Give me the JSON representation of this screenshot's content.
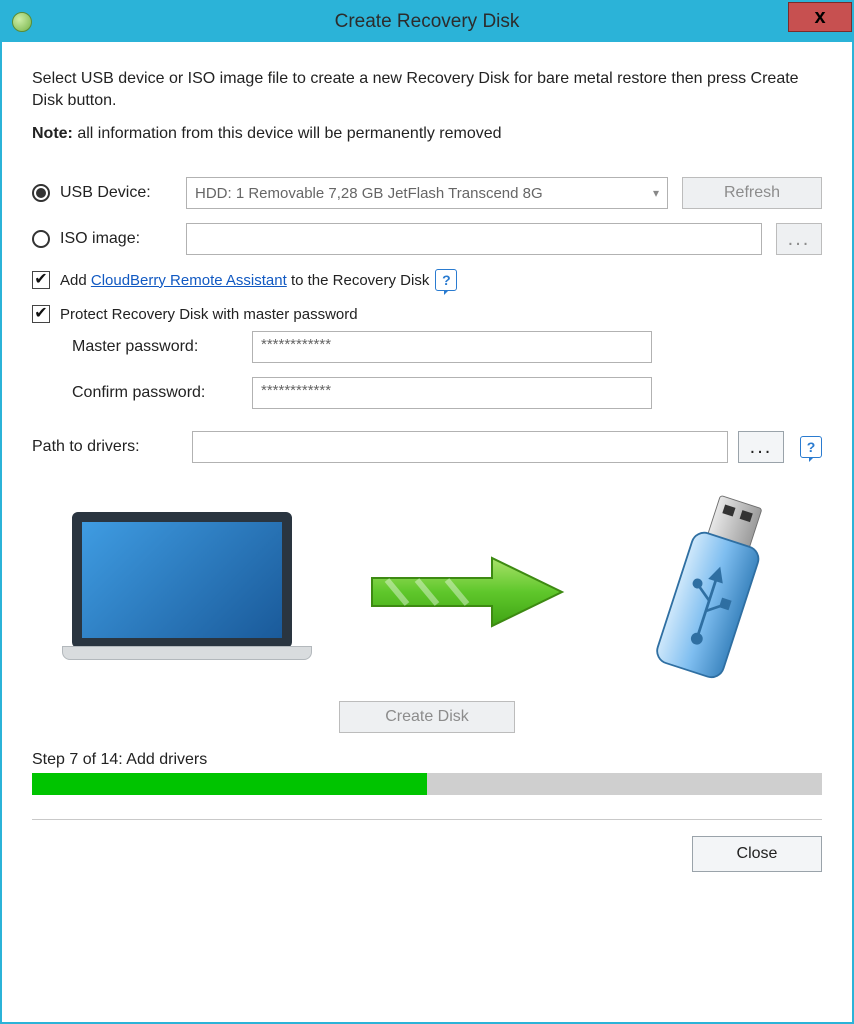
{
  "window": {
    "title": "Create Recovery Disk",
    "close_label": "x"
  },
  "intro": "Select USB device or ISO image file to create a new Recovery Disk for bare metal restore then press Create Disk button.",
  "note_prefix": "Note:",
  "note_text": "  all information from this device will be permanently removed",
  "target": {
    "usb": {
      "label": "USB Device:",
      "selected": true,
      "value": "HDD: 1 Removable 7,28 GB JetFlash Transcend 8G",
      "refresh_label": "Refresh"
    },
    "iso": {
      "label": "ISO image:",
      "selected": false,
      "value": "",
      "browse_label": "..."
    }
  },
  "options": {
    "add_remote": {
      "checked": true,
      "prefix": "Add ",
      "link_text": "CloudBerry Remote Assistant",
      "suffix": " to the Recovery Disk"
    },
    "protect": {
      "checked": true,
      "label": "Protect Recovery Disk with master password",
      "master_label": "Master password:",
      "master_value": "************",
      "confirm_label": "Confirm password:",
      "confirm_value": "************"
    }
  },
  "drivers": {
    "label": "Path to drivers:",
    "value": "",
    "browse_label": "..."
  },
  "create_button": "Create Disk",
  "progress": {
    "step_text": "Step 7 of 14: Add drivers",
    "percent": 50
  },
  "footer": {
    "close_label": "Close"
  },
  "colors": {
    "titlebar": "#2bb3d8",
    "progress_fill": "#00c400"
  }
}
